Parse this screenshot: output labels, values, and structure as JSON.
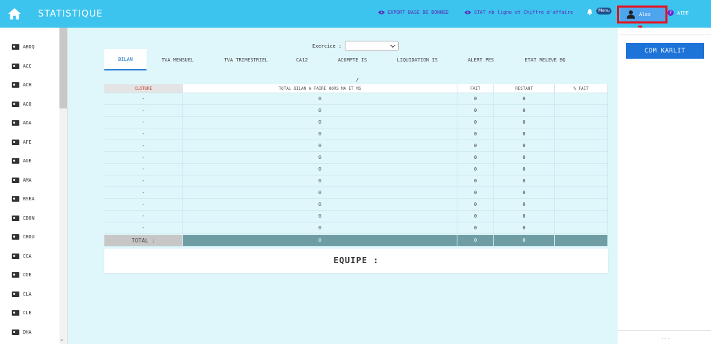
{
  "header": {
    "title": "STATISTIQUE",
    "links": [
      {
        "label": "EXPORT BASE DE DONNEE"
      },
      {
        "label": "STAT nb ligne et Chiffre d'affaire"
      }
    ],
    "menu_badge": "Menu",
    "user_name": "Alex",
    "help_label": "AIDE"
  },
  "annotation": {
    "label": "1",
    "color": "#e8101a"
  },
  "sidebar": {
    "items": [
      "ABOQ",
      "ACC",
      "ACH",
      "ACO",
      "ADA",
      "AFE",
      "AGE",
      "AMA",
      "BSEA",
      "CBON",
      "CBOU",
      "CCA",
      "CDE",
      "CLA",
      "CLE",
      "DHA"
    ]
  },
  "main": {
    "exercice_label": "Exercice :",
    "exercice_value": "",
    "tabs": [
      "BILAN",
      "TVA MENSUEL",
      "TVA TRIMESTRIEL",
      "CA12",
      "ACOMPTE IS",
      "LIQUIDATION IS",
      "ALERT PES",
      "ETAT RELEVE BQ"
    ],
    "active_tab": "BILAN",
    "slash": "/",
    "table": {
      "headers": [
        "CLOTURE",
        "TOTAL BILAN A FAIRE HORS MA ET MS",
        "FAIT",
        "RESTANT",
        "% FAIT"
      ],
      "rows": [
        [
          "-",
          "0",
          "0",
          "0",
          ""
        ],
        [
          "-",
          "0",
          "0",
          "0",
          ""
        ],
        [
          "-",
          "0",
          "0",
          "0",
          ""
        ],
        [
          "-",
          "0",
          "0",
          "0",
          ""
        ],
        [
          "-",
          "0",
          "0",
          "0",
          ""
        ],
        [
          "-",
          "0",
          "0",
          "0",
          ""
        ],
        [
          "-",
          "0",
          "0",
          "0",
          ""
        ],
        [
          "-",
          "0",
          "0",
          "0",
          ""
        ],
        [
          "-",
          "0",
          "0",
          "0",
          ""
        ],
        [
          "-",
          "0",
          "0",
          "0",
          ""
        ],
        [
          "-",
          "0",
          "0",
          "0",
          ""
        ],
        [
          "-",
          "0",
          "0",
          "0",
          ""
        ]
      ],
      "total": [
        "TOTAL :",
        "0",
        "0",
        "0",
        ""
      ]
    },
    "equipe_label": "EQUIPE :"
  },
  "right_panel": {
    "button_label": "CDM KARLIT",
    "footer": "..."
  },
  "colors": {
    "header_bg": "#3cc3ee",
    "main_bg": "#dff6fb",
    "accent": "#1e73d9",
    "total_row": "#6e9ea3"
  }
}
